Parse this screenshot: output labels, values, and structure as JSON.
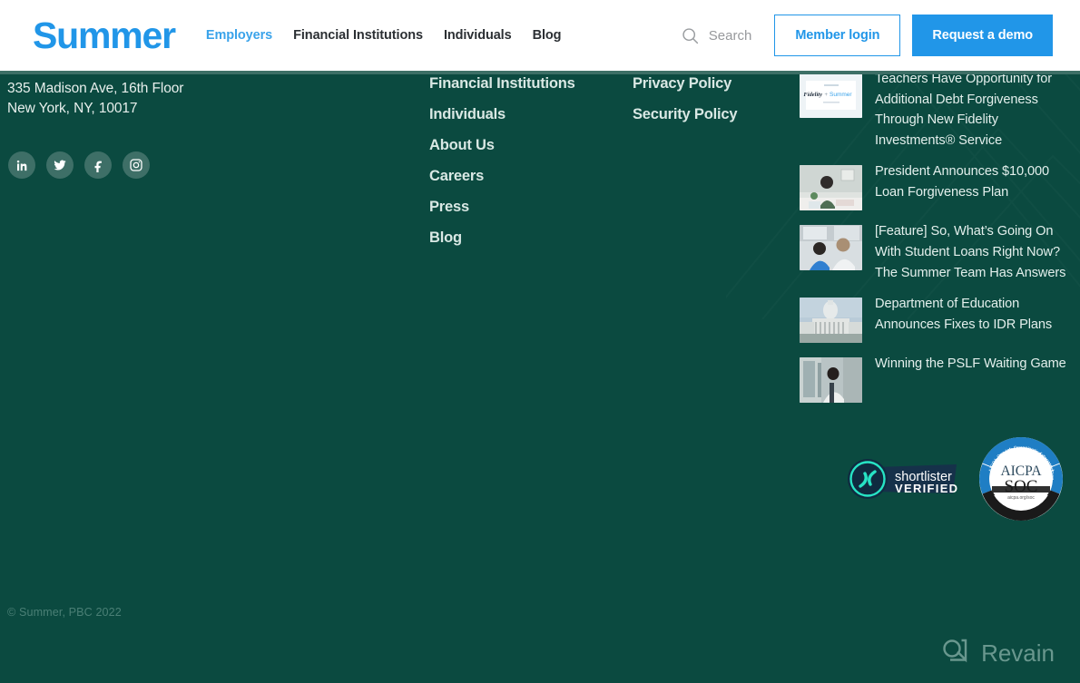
{
  "header": {
    "logo_text": "Summer",
    "logo_color": "#2196e8",
    "nav": [
      {
        "label": "Employers",
        "active": true
      },
      {
        "label": "Financial Institutions",
        "active": false
      },
      {
        "label": "Individuals",
        "active": false
      },
      {
        "label": "Blog",
        "active": false
      }
    ],
    "search": {
      "icon": "search-icon",
      "label": "Search"
    },
    "member_login_label": "Member login",
    "request_demo_label": "Request a demo"
  },
  "footer": {
    "background_color": "#0b4a40",
    "address": {
      "line1": "335 Madison Ave, 16th Floor",
      "line2": "New York, NY, 10017"
    },
    "socials": [
      {
        "name": "linkedin-icon",
        "label": "LinkedIn"
      },
      {
        "name": "twitter-icon",
        "label": "Twitter"
      },
      {
        "name": "facebook-icon",
        "label": "Facebook"
      },
      {
        "name": "instagram-icon",
        "label": "Instagram"
      }
    ],
    "column_a": [
      {
        "label": "Financial Institutions"
      },
      {
        "label": "Individuals"
      },
      {
        "label": "About Us"
      },
      {
        "label": "Careers"
      },
      {
        "label": "Press"
      },
      {
        "label": "Blog"
      }
    ],
    "column_b": [
      {
        "label": "Privacy Policy"
      },
      {
        "label": "Security Policy"
      }
    ],
    "posts": [
      {
        "title": "Teachers Have Opportunity for Additional Debt Forgiveness Through New Fidelity Investments® Service",
        "thumb": "fidelity-summer-thumbnail"
      },
      {
        "title": "President Announces $10,000 Loan Forgiveness Plan",
        "thumb": "person-at-desk-thumbnail"
      },
      {
        "title": "[Feature] So, What’s Going On With Student Loans Right Now? The Summer Team Has Answers",
        "thumb": "people-talking-thumbnail"
      },
      {
        "title": "Department of Education Announces Fixes to IDR Plans",
        "thumb": "us-capitol-thumbnail"
      },
      {
        "title": "Winning the PSLF Waiting Game",
        "thumb": "commuter-train-thumbnail"
      }
    ],
    "badges": [
      {
        "name": "shortlister-verified-badge",
        "line1": "shortlister",
        "line2": "VERIFIED"
      },
      {
        "name": "aicpa-soc-badge",
        "top_arc": "AICPA Service Organization Control Reports",
        "line1": "AICPA",
        "line2": "SOC",
        "line3": "aicpa.org/soc",
        "bottom_arc": "Formerly SAS 70 Reports"
      }
    ],
    "copyright": "© Summer, PBC 2022"
  },
  "watermark": {
    "text": "Revain",
    "icon": "revain-logo-icon"
  }
}
